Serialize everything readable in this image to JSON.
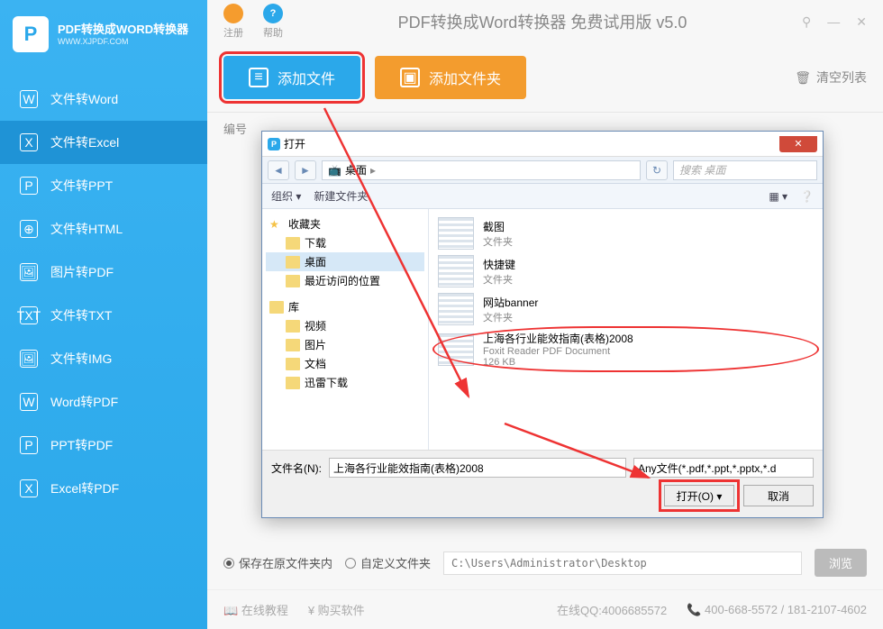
{
  "brand": {
    "name": "PDF转换成WORD转换器",
    "url": "WWW.XJPDF.COM",
    "logo_letter": "P"
  },
  "topbar": {
    "register": "注册",
    "help": "帮助",
    "title": "PDF转换成Word转换器 免费试用版 v5.0"
  },
  "sidebar": {
    "items": [
      {
        "icon": "W",
        "label": "文件转Word"
      },
      {
        "icon": "X",
        "label": "文件转Excel"
      },
      {
        "icon": "P",
        "label": "文件转PPT"
      },
      {
        "icon": "⊕",
        "label": "文件转HTML"
      },
      {
        "icon": "🖼",
        "label": "图片转PDF"
      },
      {
        "icon": "TXT",
        "label": "文件转TXT"
      },
      {
        "icon": "🖼",
        "label": "文件转IMG"
      },
      {
        "icon": "W",
        "label": "Word转PDF"
      },
      {
        "icon": "P",
        "label": "PPT转PDF"
      },
      {
        "icon": "X",
        "label": "Excel转PDF"
      }
    ],
    "active_index": 1
  },
  "toolbar": {
    "add_file": "添加文件",
    "add_folder": "添加文件夹",
    "clear_list": "清空列表"
  },
  "list": {
    "col_index": "编号"
  },
  "output": {
    "keep_original": "保存在原文件夹内",
    "custom_folder": "自定义文件夹",
    "path": "C:\\Users\\Administrator\\Desktop",
    "browse": "浏览"
  },
  "footer": {
    "tutorial": "在线教程",
    "buy": "购买软件",
    "qq_label": "在线QQ:",
    "qq": "4006685572",
    "phone": "400-668-5572 / 181-2107-4602"
  },
  "dialog": {
    "title": "打开",
    "path_label": "桌面",
    "search_placeholder": "搜索 桌面",
    "organize": "组织",
    "new_folder": "新建文件夹",
    "favorites": "收藏夹",
    "fav_items": [
      "下载",
      "桌面",
      "最近访问的位置"
    ],
    "lib": "库",
    "lib_items": [
      "视频",
      "图片",
      "文档",
      "迅雷下载"
    ],
    "folders": [
      {
        "name": "截图",
        "type": "文件夹"
      },
      {
        "name": "快捷键",
        "type": "文件夹"
      },
      {
        "name": "网站banner",
        "type": "文件夹"
      }
    ],
    "file_sel": {
      "name": "上海各行业能效指南(表格)2008",
      "type": "Foxit Reader PDF Document",
      "size": "126 KB"
    },
    "filename_label": "文件名(N):",
    "filename_value": "上海各行业能效指南(表格)2008",
    "filetype": "Any文件(*.pdf,*.ppt,*.pptx,*.d",
    "open_btn": "打开(O)",
    "cancel_btn": "取消"
  }
}
